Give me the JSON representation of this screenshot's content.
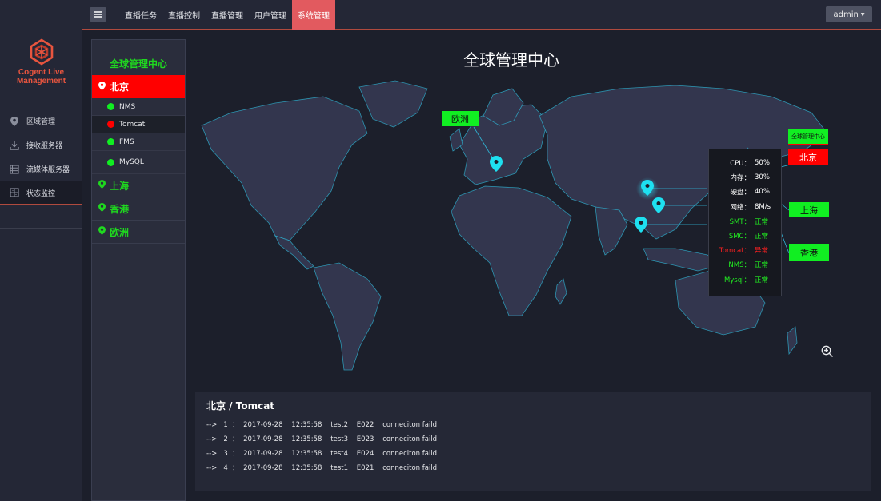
{
  "brand": {
    "line1": "Cogent Live",
    "line2": "Management"
  },
  "sidebar": {
    "items": [
      {
        "label": "区域管理",
        "icon": "location-pin-icon"
      },
      {
        "label": "接收服务器",
        "icon": "download-tray-icon"
      },
      {
        "label": "流媒体服务器",
        "icon": "server-list-icon"
      },
      {
        "label": "状态监控",
        "icon": "monitor-grid-icon",
        "active": true
      }
    ]
  },
  "topbar": {
    "menu_icon": "hamburger-menu-icon",
    "nav": [
      {
        "label": "直播任务"
      },
      {
        "label": "直播控制"
      },
      {
        "label": "直播管理"
      },
      {
        "label": "用户管理"
      },
      {
        "label": "系统管理",
        "active": true
      }
    ],
    "user": {
      "label": "admin"
    }
  },
  "regions": {
    "title": "全球管理中心",
    "beijing": {
      "name": "北京",
      "servers": [
        {
          "name": "NMS",
          "status": "ok"
        },
        {
          "name": "Tomcat",
          "status": "error"
        },
        {
          "name": "FMS",
          "status": "ok"
        },
        {
          "name": "MySQL",
          "status": "ok"
        }
      ]
    },
    "others": [
      {
        "name": "上海"
      },
      {
        "name": "香港"
      },
      {
        "name": "欧洲"
      }
    ]
  },
  "map": {
    "title": "全球管理中心",
    "tags": {
      "europe": "欧洲",
      "center": "全球管理中心",
      "beijing": "北京",
      "shanghai": "上海",
      "hongkong": "香港"
    },
    "stats": [
      {
        "label": "CPU：",
        "value": "50%",
        "color": "#ffffff"
      },
      {
        "label": "内存：",
        "value": "30%",
        "color": "#ffffff"
      },
      {
        "label": "硬盘：",
        "value": "40%",
        "color": "#ffffff"
      },
      {
        "label": "网络：",
        "value": "8M/s",
        "color": "#ffffff"
      },
      {
        "label": "SMT：",
        "value": "正常",
        "color": "#22ee22"
      },
      {
        "label": "SMC：",
        "value": "正常",
        "color": "#22ee22"
      },
      {
        "label": "Tomcat：",
        "value": "异常",
        "color": "#ff2020"
      },
      {
        "label": "NMS：",
        "value": "正常",
        "color": "#22ee22"
      },
      {
        "label": "Mysql：",
        "value": "正常",
        "color": "#22ee22"
      }
    ]
  },
  "log": {
    "title": "北京 / Tomcat",
    "entries": [
      {
        "line": "-->   1  ：  2017-09-28    12:35:58    test2    E022    conneciton faild"
      },
      {
        "line": "-->   2  ：  2017-09-28    12:35:58    test3    E023    conneciton faild"
      },
      {
        "line": "-->   3  ：  2017-09-28    12:35:58    test4    E024    conneciton faild"
      },
      {
        "line": "-->   4  ：  2017-09-28    12:35:58    test1    E021    conneciton faild"
      }
    ]
  },
  "colors": {
    "accent": "#e25a5f",
    "ok": "#11ee22",
    "error": "#ff0000",
    "map_land": "#33364e",
    "map_coast": "#2fb8d8"
  }
}
